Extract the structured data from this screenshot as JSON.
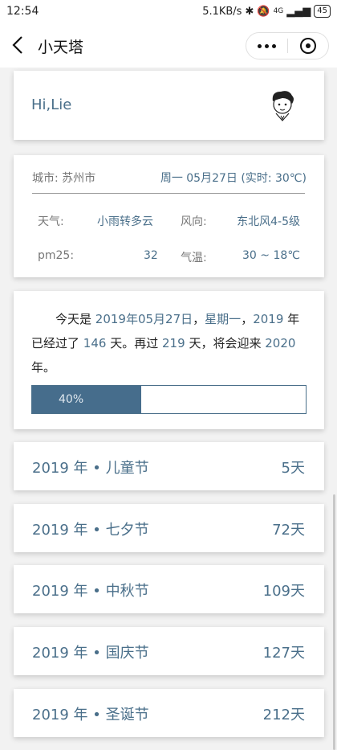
{
  "status_bar": {
    "time": "12:54",
    "network_speed": "5.1KB/s",
    "signal": "4G",
    "battery": "45"
  },
  "nav": {
    "title": "小天塔"
  },
  "greeting": {
    "text": "Hi,Lie"
  },
  "weather": {
    "city": "城市: 苏州市",
    "date": "周一 05月27日 (实时: 30℃)",
    "rows": [
      {
        "label1": "天气:",
        "value1": "小雨转多云",
        "label2": "风向:",
        "value2": "东北风4-5级"
      },
      {
        "label1": "pm25:",
        "value1": "32",
        "label2": "气温:",
        "value2": "30 ~ 18℃"
      }
    ]
  },
  "year_progress": {
    "t1": "今天是",
    "date": "2019年05月27日",
    "comma1": "，",
    "weekday": "星期一",
    "comma2": "，",
    "year": "2019",
    "t2": "年已经过了",
    "passed": "146",
    "t3": "天。再过",
    "remaining": "219",
    "t4": "天，将会迎来",
    "next_year": "2020",
    "t5": "年。",
    "percent_label": "40%",
    "percent": 40
  },
  "festivals": [
    {
      "name": "2019 年 • 儿童节",
      "days": "5天"
    },
    {
      "name": "2019 年 • 七夕节",
      "days": "72天"
    },
    {
      "name": "2019 年 • 中秋节",
      "days": "109天"
    },
    {
      "name": "2019 年 • 国庆节",
      "days": "127天"
    },
    {
      "name": "2019 年 • 圣诞节",
      "days": "212天"
    }
  ]
}
